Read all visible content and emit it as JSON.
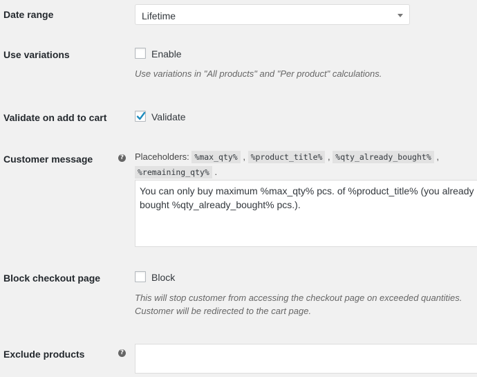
{
  "date_range": {
    "label": "Date range",
    "selected": "Lifetime"
  },
  "use_variations": {
    "label": "Use variations",
    "checkbox_label": "Enable",
    "checked": false,
    "description": "Use variations in \"All products\" and \"Per product\" calculations."
  },
  "validate": {
    "label": "Validate on add to cart",
    "checkbox_label": "Validate",
    "checked": true
  },
  "customer_message": {
    "label": "Customer message",
    "placeholders_label": "Placeholders:",
    "placeholders": [
      "%max_qty%",
      "%product_title%",
      "%qty_already_bought%",
      "%remaining_qty%"
    ],
    "value": "You can only buy maximum %max_qty% pcs. of %product_title% (you already bought %qty_already_bought% pcs.)."
  },
  "block_checkout": {
    "label": "Block checkout page",
    "checkbox_label": "Block",
    "checked": false,
    "description_line1": "This will stop customer from accessing the checkout page on exceeded quantities.",
    "description_line2": "Customer will be redirected to the cart page."
  },
  "exclude_products": {
    "label": "Exclude products",
    "value": ""
  },
  "icons": {
    "help": "help-icon",
    "dropdown": "chevron-down-icon",
    "check": "checkmark-icon"
  },
  "colors": {
    "background": "#f1f1f1",
    "checkmark": "#1e8cbe",
    "field_border": "#dddddd"
  }
}
